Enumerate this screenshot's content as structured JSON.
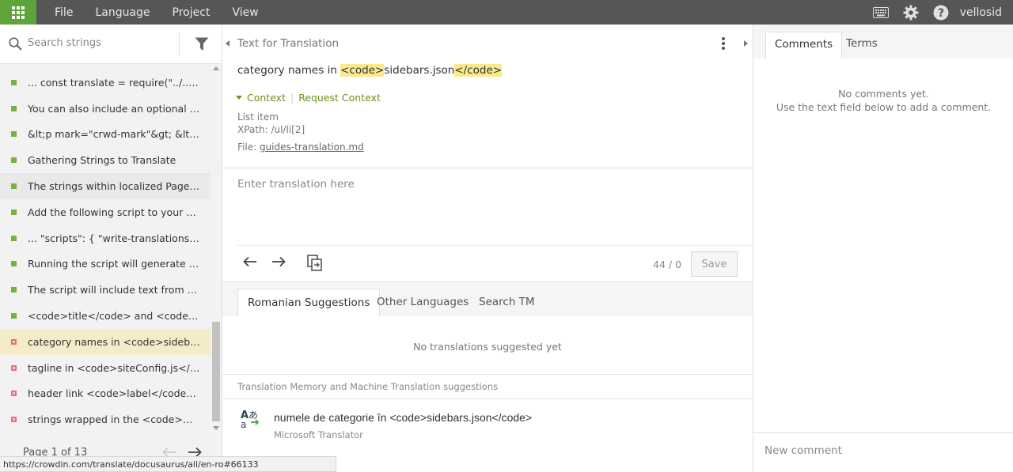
{
  "topbar": {
    "menu": [
      "File",
      "Language",
      "Project",
      "View"
    ],
    "username": "vellosid",
    "accent": "#5fa33b"
  },
  "left": {
    "search_placeholder": "Search strings",
    "items": [
      {
        "text": "... const translate = require(\"../../serv...",
        "status": "translated"
      },
      {
        "text": "You can also include an optional des...",
        "status": "translated"
      },
      {
        "text": "&lt;p mark=\"crwd-mark\"&gt; &lt;tran...",
        "status": "translated"
      },
      {
        "text": "Gathering Strings to Translate",
        "status": "translated"
      },
      {
        "text": "The strings within localized Pages m...",
        "status": "translated"
      },
      {
        "text": "Add the following script to your pack...",
        "status": "translated"
      },
      {
        "text": "... \"scripts\": { \"write-translations\": \"d...",
        "status": "translated"
      },
      {
        "text": "Running the script will generate a <c...",
        "status": "translated"
      },
      {
        "text": "The script will include text from the f...",
        "status": "translated"
      },
      {
        "text": "<code>title</code> and <code>side...",
        "status": "translated"
      },
      {
        "text": "category names in <code>sidebars.j...",
        "status": "untranslated"
      },
      {
        "text": "tagline in <code>siteConfig.js</code>",
        "status": "untranslated"
      },
      {
        "text": "header link <code>label</code> stri...",
        "status": "untranslated"
      },
      {
        "text": "strings wrapped in the <code>&lt;tra...",
        "status": "untranslated"
      }
    ],
    "page_label": "Page 1 of 13"
  },
  "statusbar": {
    "url": "https://crowdin.com/translate/docusaurus/all/en-ro#66133"
  },
  "center": {
    "header": "Text for Translation",
    "source": {
      "before": "category names in ",
      "tag_open": "<code>",
      "middle": "sidebars.json",
      "tag_close": "</code>"
    },
    "context_link": "Context",
    "request_context": "Request Context",
    "context_type": "List item",
    "xpath": "XPath: /ul/li[2]",
    "file_label": "File: ",
    "file_name": "guides-translation.md",
    "translation_placeholder": "Enter translation here",
    "counter": "44 / 0",
    "save_label": "Save",
    "tabs": [
      "Romanian Suggestions",
      "Other Languages",
      "Search TM"
    ],
    "no_suggestions": "No translations suggested yet",
    "tm_label": "Translation Memory and Machine Translation suggestions",
    "mt_text": "numele de categorie în <code>sidebars.json</code>",
    "mt_source": "Microsoft Translator"
  },
  "right": {
    "tabs": [
      "Comments",
      "Terms"
    ],
    "no_comments_1": "No comments yet.",
    "no_comments_2": "Use the text field below to add a comment.",
    "comment_placeholder": "New comment"
  }
}
